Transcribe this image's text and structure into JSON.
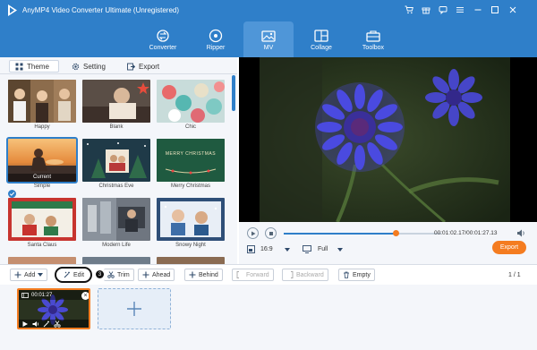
{
  "app": {
    "title": "AnyMP4 Video Converter Ultimate (Unregistered)"
  },
  "window_controls": [
    "cart-icon",
    "gift-icon",
    "chat-icon",
    "menu-icon",
    "minimize-icon",
    "maximize-icon",
    "close-icon"
  ],
  "nav": {
    "tabs": [
      {
        "label": "Converter",
        "icon": "convert-icon"
      },
      {
        "label": "Ripper",
        "icon": "disc-icon"
      },
      {
        "label": "MV",
        "icon": "mv-icon",
        "active": true
      },
      {
        "label": "Collage",
        "icon": "collage-icon"
      },
      {
        "label": "Toolbox",
        "icon": "toolbox-icon"
      }
    ]
  },
  "subtabs": [
    {
      "label": "Theme",
      "icon": "grid-icon",
      "active": true
    },
    {
      "label": "Setting",
      "icon": "gear-icon"
    },
    {
      "label": "Export",
      "icon": "export-icon"
    }
  ],
  "themes": [
    {
      "label": "Happy"
    },
    {
      "label": "Blank"
    },
    {
      "label": "Chic"
    },
    {
      "label": "Simple",
      "selected": true,
      "badge": "Current"
    },
    {
      "label": "Christmas Eve"
    },
    {
      "label": "Merry Christmas",
      "overlay_text": "MERRY CHRISTMAS"
    },
    {
      "label": "Santa Claus"
    },
    {
      "label": "Modern Life"
    },
    {
      "label": "Snowy Night"
    }
  ],
  "player": {
    "time_display": "00:01:02.17/00:01:27.13",
    "progress": 0.71,
    "aspect_ratio": "16:9",
    "mode": "Full",
    "export_label": "Export"
  },
  "toolbar": {
    "add": "Add",
    "edit": "Edit",
    "callout": "3",
    "trim": "Trim",
    "ahead": "Ahead",
    "behind": "Behind",
    "forward": "Forward",
    "backward": "Backward",
    "empty": "Empty",
    "page_count": "1 / 1"
  },
  "timeline": {
    "clip_time": "00:01:27",
    "add_slot_icon": "plus-icon"
  },
  "colors": {
    "brand_blue": "#2f7fc9",
    "accent_orange": "#f47c20",
    "panel_bg": "#f4f6fa"
  }
}
